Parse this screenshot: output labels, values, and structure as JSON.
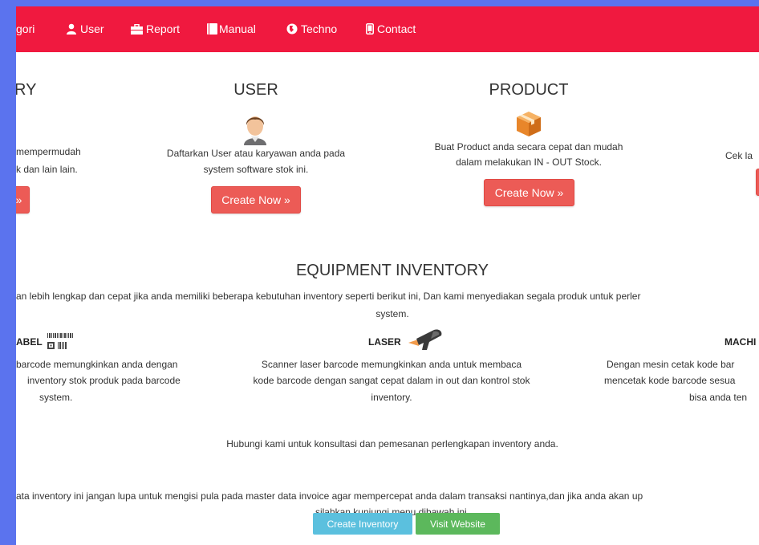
{
  "colors": {
    "frame_blue": "#5b73ee",
    "navbar_red": "#f0193f",
    "button_red": "#ec5b56",
    "button_cyan": "#5bc0de",
    "button_green": "#5cb85c"
  },
  "navbar": {
    "items": [
      {
        "label": "gori",
        "icon": ""
      },
      {
        "label": "User",
        "icon": "user-icon"
      },
      {
        "label": "Report",
        "icon": "briefcase-icon"
      },
      {
        "label": "Manual",
        "icon": "book-icon"
      },
      {
        "label": "Techno",
        "icon": "globe-icon"
      },
      {
        "label": "Contact",
        "icon": "mobile-phone-icon"
      }
    ]
  },
  "features": {
    "category": {
      "title": "RY",
      "desc_line1": "mempermudah",
      "desc_line2": "k dan lain lain.",
      "button": "»"
    },
    "user": {
      "title": "USER",
      "icon": "user-avatar-icon",
      "desc_line1": "Daftarkan User atau karyawan anda pada",
      "desc_line2": "system software stok ini.",
      "button": "Create Now »"
    },
    "product": {
      "title": "PRODUCT",
      "icon": "product-box-icon",
      "desc_line1": "Buat Product anda secara cepat dan mudah",
      "desc_line2": "dalam melakukan IN - OUT Stock.",
      "button": "Create Now »"
    },
    "report": {
      "desc_line1": "Cek la"
    }
  },
  "equipment": {
    "title": "EQUIPMENT INVENTORY",
    "intro_line1": "an lebih lengkap dan cepat jika anda memiliki beberapa kebutuhan inventory seperti berikut ini, Dan kami menyediakan segala produk untuk perler",
    "intro_line2": "system.",
    "label": {
      "title": "ABEL",
      "icon": "barcode-icon",
      "desc_line1": "barcode memungkinkan anda dengan",
      "desc_line2": "inventory stok produk pada barcode",
      "desc_line3": "system."
    },
    "laser": {
      "title": "LASER",
      "icon": "barcode-scanner-icon",
      "desc_line1": "Scanner laser barcode memungkinkan anda untuk membaca",
      "desc_line2": "kode barcode dengan sangat cepat dalam in out dan kontrol stok",
      "desc_line3": "inventory."
    },
    "machine": {
      "title": "MACHI",
      "desc_line1": "Dengan mesin cetak kode bar",
      "desc_line2": "mencetak kode barcode sesua",
      "desc_line3": "bisa anda ten"
    },
    "contact_text": "Hubungi kami untuk konsultasi dan pemesanan perlengkapan inventory anda."
  },
  "footer": {
    "text_line1": "ata inventory ini jangan lupa untuk mengisi pula pada master data invoice agar mempercepat anda dalam transaksi nantinya,dan jika anda akan up",
    "text_line2": "silahkan kunjungi menu dibawah ini.",
    "create_inventory": "Create Inventory",
    "visit_website": "Visit Website"
  }
}
